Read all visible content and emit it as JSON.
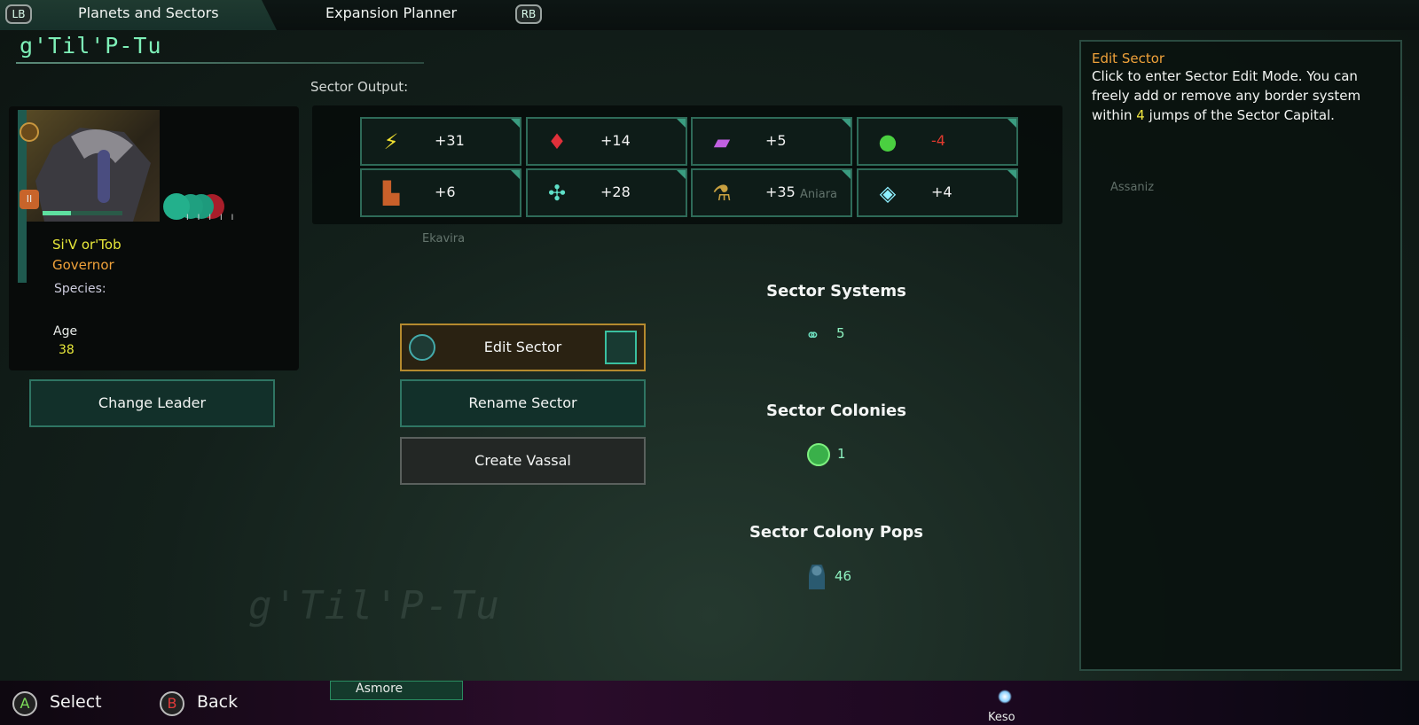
{
  "topbar": {
    "lb": "LB",
    "rb": "RB",
    "tabs": [
      {
        "label": "Planets and Sectors",
        "active": true
      },
      {
        "label": "Expansion Planner",
        "active": false
      }
    ]
  },
  "sector": {
    "name": "g'Til'P-Tu",
    "output_label": "Sector Output:"
  },
  "output": [
    {
      "icon": "energy-icon",
      "value": "+31",
      "color": "#f3f3f3"
    },
    {
      "icon": "minerals-icon",
      "value": "+14",
      "color": "#f3f3f3"
    },
    {
      "icon": "alloys-icon",
      "value": "+5",
      "color": "#f3f3f3"
    },
    {
      "icon": "food-icon",
      "value": "-4",
      "color": "#e03a2e"
    },
    {
      "icon": "consumer-goods-icon",
      "value": "+6",
      "color": "#f3f3f3"
    },
    {
      "icon": "unity-icon",
      "value": "+28",
      "color": "#f3f3f3"
    },
    {
      "icon": "research-icon",
      "value": "+35",
      "color": "#f3f3f3"
    },
    {
      "icon": "amenities-icon",
      "value": "+4",
      "color": "#f3f3f3"
    }
  ],
  "leader": {
    "name": "Si'V or'Tob",
    "role": "Governor",
    "species_label": "Species:",
    "age_label": "Age",
    "age": "38",
    "level": "II",
    "trait_levels": [
      "II",
      "I",
      "I",
      "I"
    ],
    "xp_fraction": 0.35,
    "change_label": "Change Leader"
  },
  "actions": {
    "edit": "Edit Sector",
    "rename": "Rename Sector",
    "vassal": "Create Vassal"
  },
  "stats": {
    "systems_label": "Sector Systems",
    "systems": "5",
    "colonies_label": "Sector Colonies",
    "colonies": "1",
    "pops_label": "Sector Colony Pops",
    "pops": "46"
  },
  "tooltip": {
    "title": "Edit Sector",
    "body_pre": "Click to enter Sector Edit Mode. You can freely add or remove any border system within ",
    "highlight": "4",
    "body_post": " jumps of the Sector Capital."
  },
  "map": {
    "labels": [
      "Ekavira",
      "Aniara",
      "Assaniz",
      "Asmore",
      "Keso"
    ]
  },
  "footer": {
    "a_key": "A",
    "a_label": "Select",
    "b_key": "B",
    "b_label": "Back"
  }
}
